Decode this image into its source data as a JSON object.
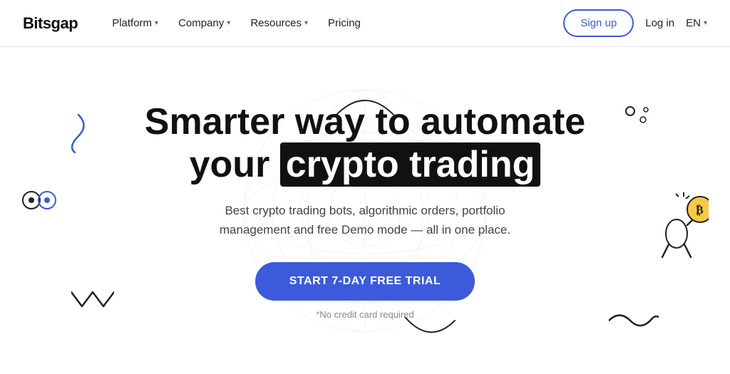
{
  "logo": "Bitsgap",
  "nav": {
    "platform_label": "Platform",
    "company_label": "Company",
    "resources_label": "Resources",
    "pricing_label": "Pricing",
    "signup_label": "Sign up",
    "login_label": "Log in",
    "lang_label": "EN"
  },
  "hero": {
    "title_line1": "Smarter way to automate",
    "title_line2_plain": "your ",
    "title_line2_highlight": "crypto trading",
    "subtitle": "Best crypto trading bots, algorithmic orders, portfolio management and free Demo mode — all in one place.",
    "cta_label": "START 7-DAY FREE TRIAL",
    "no_cc_label": "*No credit card required"
  }
}
